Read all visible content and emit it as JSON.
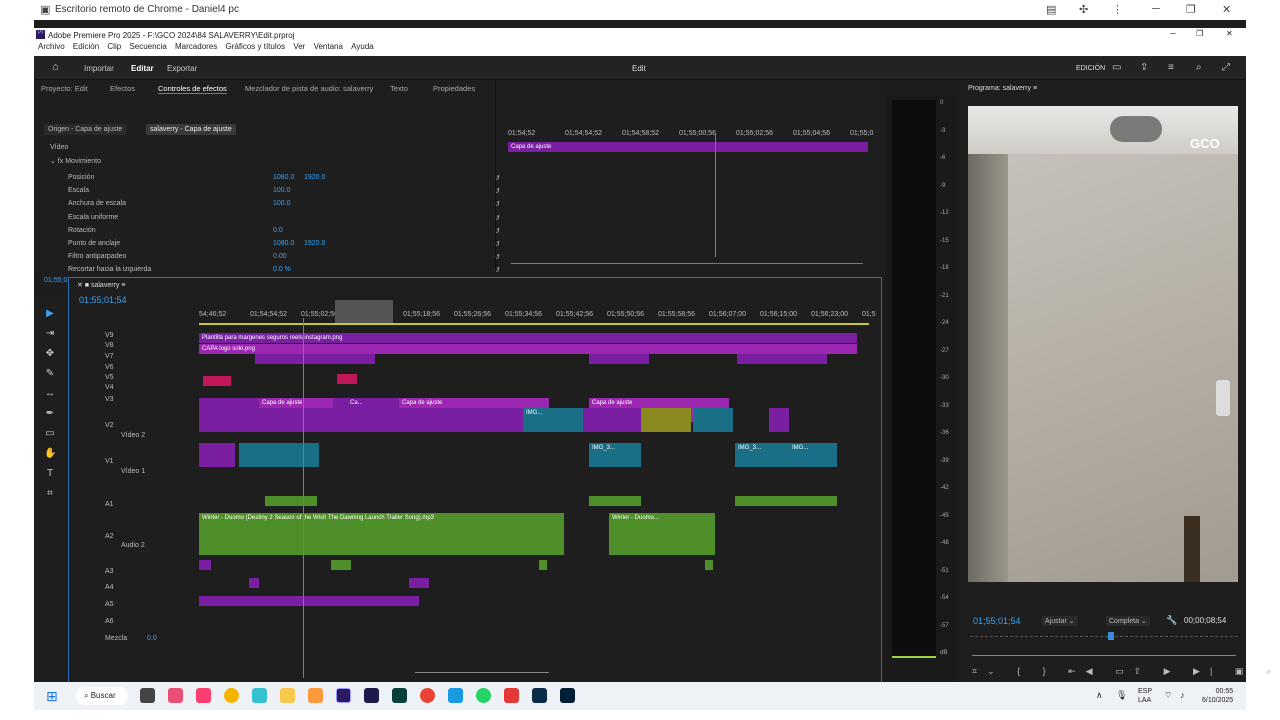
{
  "chrome": {
    "title": "Escritorio remoto de Chrome - Daniel4 pc"
  },
  "pp": {
    "title": "Adobe Premiere Pro 2025 - F:\\GCO 2024\\84 SALAVERRY\\Edit.prproj",
    "menu": [
      "Archivo",
      "Edición",
      "Clip",
      "Secuencia",
      "Marcadores",
      "Gráficos y títulos",
      "Ver",
      "Ventana",
      "Ayuda"
    ]
  },
  "workspace": {
    "tabs": [
      "Importar",
      "Editar",
      "Exportar"
    ],
    "center": "Edit",
    "right": "EDICIÓN"
  },
  "effects": {
    "tabs": [
      "Proyecto: Edit",
      "Efectos",
      "Controles de efectos",
      "Mezclador de pista de audio: salaverry",
      "Texto",
      "Propiedades"
    ],
    "source": "Origen - Capa de ajuste",
    "target": "salaverry - Capa de ajuste",
    "section": "Vídeo",
    "group": "Movimiento",
    "props": [
      {
        "name": "Posición",
        "v1": "1080.0",
        "v2": "1920.0"
      },
      {
        "name": "Escala",
        "v1": "100.0",
        "v2": ""
      },
      {
        "name": "Anchura de escala",
        "v1": "100.0",
        "v2": ""
      },
      {
        "name": "Escala uniforme",
        "v1": "",
        "v2": ""
      },
      {
        "name": "Rotación",
        "v1": "0.0",
        "v2": ""
      },
      {
        "name": "Punto de anclaje",
        "v1": "1080.0",
        "v2": "1920.0"
      },
      {
        "name": "Filtro antiparpadeo",
        "v1": "0.00",
        "v2": ""
      },
      {
        "name": "Recortar hacia la izquierda",
        "v1": "0.0 %",
        "v2": ""
      }
    ],
    "ruler": [
      "01;54;52",
      "01;54;54;52",
      "01;54;58;52",
      "01;55;00;56",
      "01;55;02;56",
      "01;55;04;56",
      "01;55;0"
    ],
    "clip": "Capa de ajuste",
    "time": "01;55;01;54"
  },
  "timeline": {
    "name": "salaverry",
    "time": "01;55;01;54",
    "ruler": [
      "54;46;52",
      "01;54;54;52",
      "01;55;02;56",
      "01;55;10;56",
      "01;55;18;56",
      "01;55;26;56",
      "01;55;34;56",
      "01;55;42;56",
      "01;55;50;56",
      "01;55;58;56",
      "01;56;07;00",
      "01;56;15;00",
      "01;56;23;00",
      "01;5"
    ],
    "vtracks": [
      "V9",
      "V8",
      "V7",
      "V6",
      "V5",
      "V4",
      "V3",
      "V2",
      "V1"
    ],
    "v2label": "Vídeo 2",
    "v1label": "Vídeo 1",
    "atracks": [
      "A1",
      "A2",
      "A3",
      "A4",
      "A5",
      "A6"
    ],
    "a2label": "Audio 2",
    "mix": "Mezcla",
    "mixval": "0.0",
    "clips": {
      "plantilla": "Plantilla para margenes seguros reels instagram.png",
      "logo": "CAPA logo solo.png",
      "adj1": "Capa de ajuste",
      "adj2": "Ca...",
      "adj3": "Capa de ajuste",
      "adj4": "Capa de ajuste",
      "img1": "IMG...",
      "img2": "IMG_3...",
      "img3": "IMG_3...",
      "img4": "IMG...",
      "audio1": "Winter - Duomo (Destiny 2 Season of the Wish The Dawning Launch Trailer Song).mp3",
      "audio2": "Winter - Duomo..."
    }
  },
  "meter": [
    "0",
    "-3",
    "-6",
    "-9",
    "-12",
    "-15",
    "-18",
    "-21",
    "-24",
    "-27",
    "-30",
    "-33",
    "-36",
    "-39",
    "-42",
    "-45",
    "-48",
    "-51",
    "-54",
    "-57",
    "dB"
  ],
  "program": {
    "title": "Programa: salaverry",
    "time": "01;55;01;54",
    "fit": "Ajustar",
    "quality": "Completa",
    "duration": "00;00;08;54",
    "logo": "GCO"
  },
  "taskbar": {
    "search": "Buscar",
    "lang1": "ESP",
    "lang2": "LAA",
    "clock": "00:55",
    "date": "6/10/2025"
  }
}
